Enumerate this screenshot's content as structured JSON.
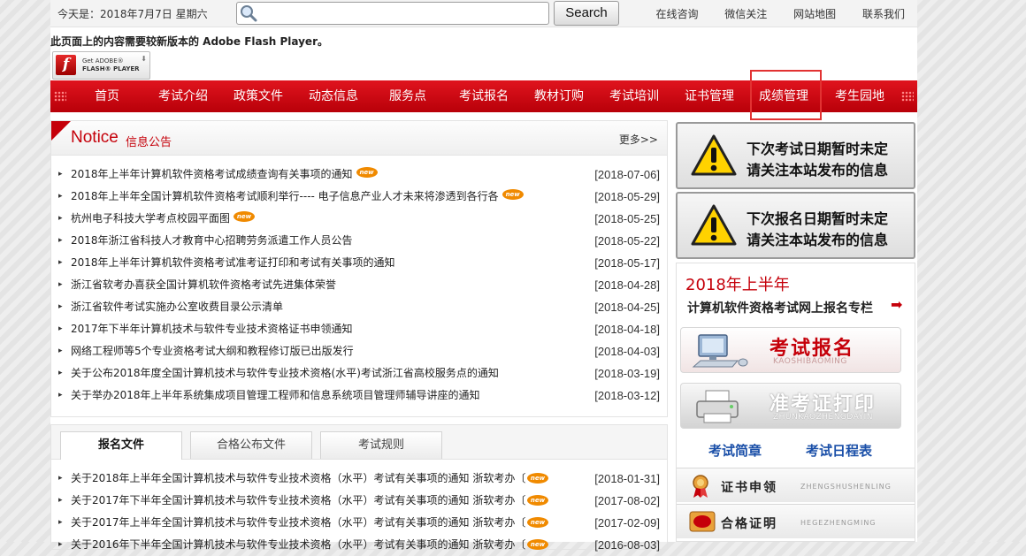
{
  "topbar": {
    "today": "今天是：2018年7月7日  星期六",
    "search_value": "",
    "search_button": "Search",
    "links": [
      "在线咨询",
      "微信关注",
      "网站地图",
      "联系我们"
    ]
  },
  "flash": {
    "message": "此页面上的内容需要较新版本的 Adobe Flash Player。",
    "badge_line1": "Get ADOBE®",
    "badge_line2": "FLASH® PLAYER"
  },
  "nav": {
    "items": [
      "首页",
      "考试介绍",
      "政策文件",
      "动态信息",
      "服务点",
      "考试报名",
      "教材订购",
      "考试培训",
      "证书管理",
      "成绩管理",
      "考生园地"
    ],
    "highlighted": "成绩管理"
  },
  "notice": {
    "title_en": "Notice",
    "title_cn": "信息公告",
    "more": "更多>>",
    "new_badge": "new",
    "items": [
      {
        "title": "2018年上半年计算机软件资格考试成绩查询有关事项的通知",
        "date": "[2018-07-06]",
        "new": true
      },
      {
        "title": "2018年上半年全国计算机软件资格考试顺利举行---- 电子信息产业人才未来将渗透到各行各",
        "date": "[2018-05-29]",
        "new": true
      },
      {
        "title": "杭州电子科技大学考点校园平面图",
        "date": "[2018-05-25]",
        "new": true
      },
      {
        "title": "2018年浙江省科技人才教育中心招聘劳务派遣工作人员公告",
        "date": "[2018-05-22]",
        "new": false
      },
      {
        "title": "2018年上半年计算机软件资格考试准考证打印和考试有关事项的通知",
        "date": "[2018-05-17]",
        "new": false
      },
      {
        "title": "浙江省软考办喜获全国计算机软件资格考试先进集体荣誉",
        "date": "[2018-04-28]",
        "new": false
      },
      {
        "title": "浙江省软件考试实施办公室收费目录公示清单",
        "date": "[2018-04-25]",
        "new": false
      },
      {
        "title": "2017年下半年计算机技术与软件专业技术资格证书申领通知",
        "date": "[2018-04-18]",
        "new": false
      },
      {
        "title": "网络工程师等5个专业资格考试大纲和教程修订版已出版发行",
        "date": "[2018-04-03]",
        "new": false
      },
      {
        "title": "关于公布2018年度全国计算机技术与软件专业技术资格(水平)考试浙江省高校服务点的通知",
        "date": "[2018-03-19]",
        "new": false
      },
      {
        "title": "关于举办2018年上半年系统集成项目管理工程师和信息系统项目管理师辅导讲座的通知",
        "date": "[2018-03-12]",
        "new": false
      }
    ]
  },
  "tabs": {
    "labels": [
      "报名文件",
      "合格公布文件",
      "考试规则"
    ],
    "active": "报名文件",
    "items": [
      {
        "title": "关于2018年上半年全国计算机技术与软件专业技术资格（水平）考试有关事项的通知 浙软考办〔",
        "date": "[2018-01-31]",
        "new": true
      },
      {
        "title": "关于2017年下半年全国计算机技术与软件专业技术资格（水平）考试有关事项的通知 浙软考办〔",
        "date": "[2017-08-02]",
        "new": true
      },
      {
        "title": "关于2017年上半年全国计算机技术与软件专业技术资格（水平）考试有关事项的通知 浙软考办〔",
        "date": "[2017-02-09]",
        "new": true
      },
      {
        "title": "关于2016年下半年全国计算机技术与软件专业技术资格（水平）考试有关事项的通知 浙软考办〔",
        "date": "[2016-08-03]",
        "new": true
      }
    ]
  },
  "right": {
    "warn_exam_date": [
      "下次考试日期暂时未定",
      "请关注本站发布的信息"
    ],
    "warn_reg_date": [
      "下次报名日期暂时未定",
      "请关注本站发布的信息"
    ],
    "reg_year": "2018年上半年",
    "reg_subtitle": "计算机软件资格考试网上报名专栏",
    "btn_register_cn": "考试报名",
    "btn_register_py": "KAOSHIBAOMING",
    "btn_ticket_cn": "准考证打印",
    "btn_ticket_py": "ZHUNKAOZHENGDAYIN",
    "link_brief": "考试简章",
    "link_schedule": "考试日程表",
    "side_cert_cn": "证书申领",
    "side_cert_py": "ZHENGSHUSHENLING",
    "side_pass_cn": "合格证明",
    "side_pass_py": "HEGEZHENGMING",
    "side_pass_badge": "合格"
  },
  "colors": {
    "brand_red": "#c5000a",
    "nav_red": "#d40a14",
    "link_blue": "#1a4fa8",
    "new_badge": "#f08a00"
  }
}
